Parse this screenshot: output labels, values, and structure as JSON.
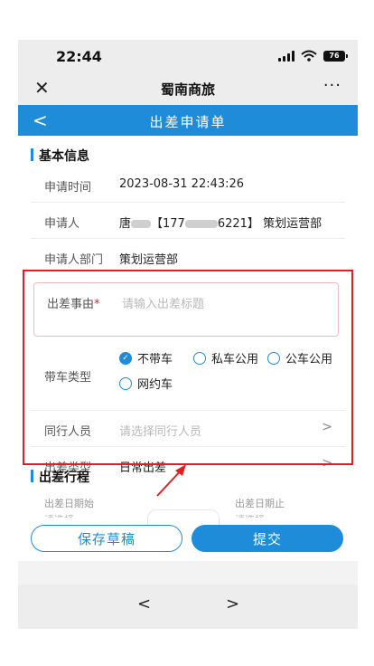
{
  "status_bar": {
    "time": "22:44",
    "battery": "76"
  },
  "app_bar": {
    "title": "蜀南商旅",
    "close_icon": "close-icon",
    "more_icon": "more-icon"
  },
  "nav_bar": {
    "title": "出差申请单",
    "back_icon": "chevron-left-icon"
  },
  "basic_info": {
    "title": "基本信息",
    "apply_time_label": "申请时间",
    "apply_time_value": "2023-08-31 22:43:26",
    "applicant_label": "申请人",
    "applicant_name": "唐",
    "applicant_phone_prefix": "【177",
    "applicant_phone_suffix": "6221】",
    "applicant_dept": "策划运营部",
    "dept_label": "申请人部门",
    "dept_value": "策划运营部"
  },
  "form": {
    "reason_label": "出差事由",
    "reason_required": "*",
    "reason_placeholder": "请输入出差标题",
    "car_type_label": "带车类型",
    "car_options": [
      {
        "label": "不带车",
        "checked": true
      },
      {
        "label": "私车公用",
        "checked": false
      },
      {
        "label": "公车公用",
        "checked": false
      },
      {
        "label": "网约车",
        "checked": false
      }
    ],
    "companions_label": "同行人员",
    "companions_placeholder": "请选择同行人员",
    "trip_type_label": "出差类型",
    "trip_type_value": "日常出差"
  },
  "itinerary": {
    "title": "出差行程",
    "start_label": "出差日期始",
    "end_label": "出差日期止",
    "start_placeholder": "请选择",
    "end_placeholder": "请选择"
  },
  "actions": {
    "save_draft": "保存草稿",
    "submit": "提交"
  },
  "browser_nav": {
    "prev": "<",
    "next": ">"
  },
  "colors": {
    "primary": "#1f8cd9",
    "highlight": "#e02020"
  }
}
